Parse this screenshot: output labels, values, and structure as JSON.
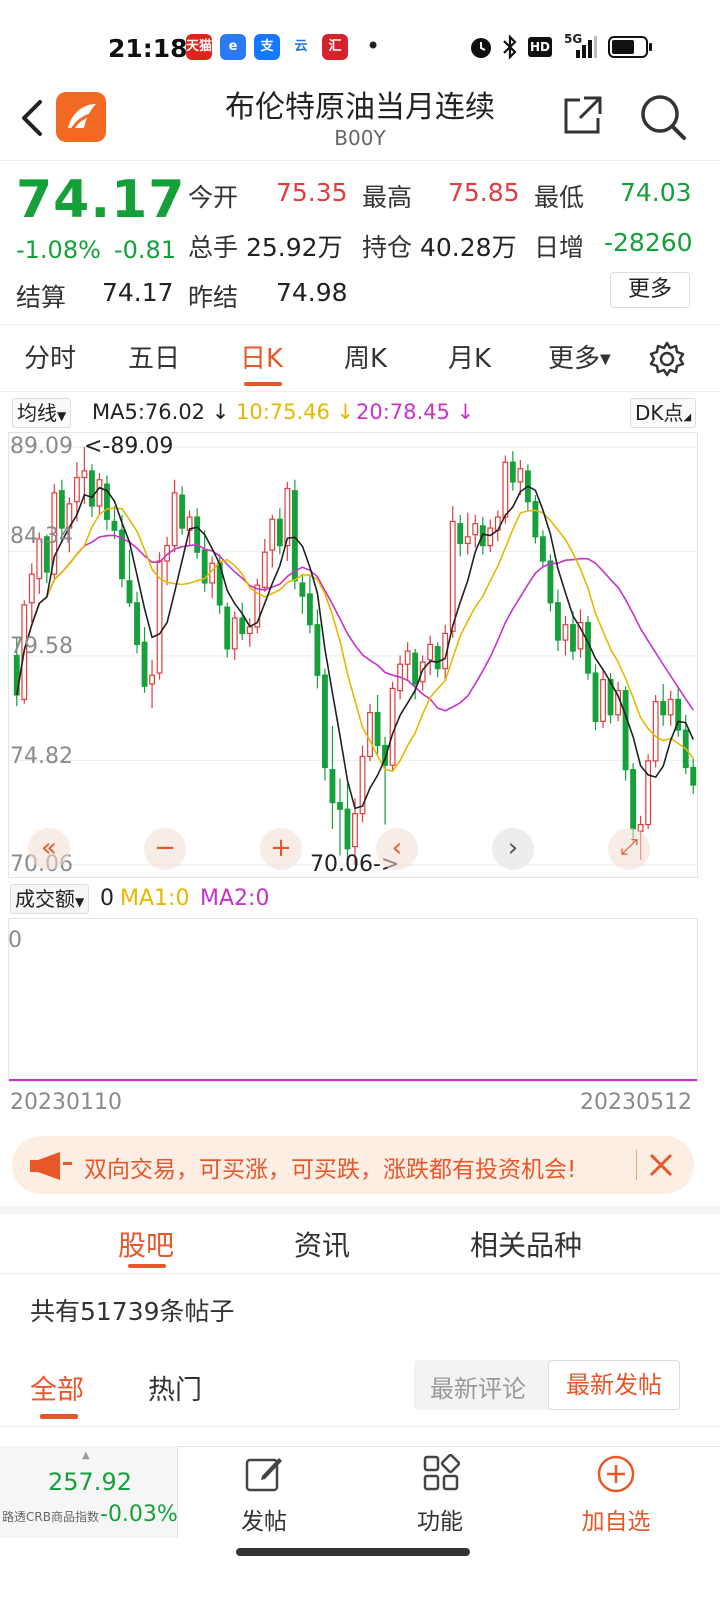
{
  "status_bar": {
    "time": "21:18",
    "apps": [
      "天猫",
      "e",
      "支",
      "云",
      "汇",
      "•"
    ],
    "network": "5G",
    "icons": [
      "alarm-icon",
      "bluetooth-icon",
      "hd-icon",
      "signal-icon",
      "battery-icon"
    ]
  },
  "header": {
    "title": "布伦特原油当月连续",
    "code": "B00Y"
  },
  "quote": {
    "price": "74.17",
    "change_pct": "-1.08%",
    "change_val": "-0.81",
    "open_label": "今开",
    "open": "75.35",
    "high_label": "最高",
    "high": "75.85",
    "low_label": "最低",
    "low": "74.03",
    "volume_label": "总手",
    "volume": "25.92万",
    "oi_label": "持仓",
    "oi": "40.28万",
    "oi_change_label": "日增",
    "oi_change": "-28260",
    "settle_label": "结算",
    "settle": "74.17",
    "prev_settle_label": "昨结",
    "prev_settle": "74.98",
    "more_label": "更多"
  },
  "period_tabs": {
    "items": [
      "分时",
      "五日",
      "日K",
      "周K",
      "月K",
      "更多"
    ],
    "active": "日K"
  },
  "ma_row": {
    "selector": "均线",
    "ma5": "MA5:76.02",
    "ma10": "10:75.46",
    "ma20": "20:78.45",
    "arrow": "↓",
    "dk_label": "DK点"
  },
  "kchart": {
    "y_labels": [
      "89.09",
      "84.34",
      "79.58",
      "74.82",
      "70.06"
    ],
    "max_label": "<-89.09",
    "min_label": "70.06->",
    "colors": {
      "up": "#e23c3c",
      "down": "#15a03a",
      "ma5": "#222222",
      "ma10": "#e6b800",
      "ma20": "#c832c8"
    }
  },
  "chart_data": {
    "type": "candlestick",
    "title": "",
    "ylim": [
      70.06,
      89.09
    ],
    "y_ticks": [
      89.09,
      84.34,
      79.58,
      74.82,
      70.06
    ],
    "x_range": [
      "20230110",
      "20230512"
    ],
    "candles": [
      [
        79.6,
        80.4,
        77.3,
        77.8
      ],
      [
        77.6,
        82.1,
        77.4,
        81.9
      ],
      [
        82.0,
        83.8,
        81.1,
        83.3
      ],
      [
        83.1,
        85.2,
        82.4,
        84.9
      ],
      [
        85.0,
        85.1,
        82.9,
        83.4
      ],
      [
        83.3,
        87.4,
        83.0,
        87.0
      ],
      [
        87.1,
        87.6,
        84.8,
        85.4
      ],
      [
        85.4,
        86.8,
        84.3,
        86.5
      ],
      [
        86.6,
        88.4,
        85.7,
        87.7
      ],
      [
        87.7,
        89.09,
        86.5,
        88.0
      ],
      [
        88.0,
        88.3,
        85.9,
        86.4
      ],
      [
        86.4,
        87.9,
        86.0,
        87.6
      ],
      [
        87.4,
        87.8,
        85.3,
        85.8
      ],
      [
        85.7,
        86.4,
        84.9,
        85.3
      ],
      [
        85.3,
        86.0,
        82.7,
        83.1
      ],
      [
        83.0,
        84.4,
        81.8,
        82.0
      ],
      [
        82.0,
        82.5,
        79.7,
        80.1
      ],
      [
        80.2,
        80.9,
        77.9,
        78.2
      ],
      [
        78.3,
        79.4,
        77.2,
        78.7
      ],
      [
        78.8,
        84.3,
        78.5,
        83.9
      ],
      [
        83.9,
        85.0,
        82.8,
        84.6
      ],
      [
        84.6,
        87.6,
        84.3,
        87.0
      ],
      [
        86.9,
        87.3,
        85.1,
        85.4
      ],
      [
        85.3,
        86.2,
        84.6,
        85.9
      ],
      [
        85.9,
        86.3,
        84.0,
        84.3
      ],
      [
        84.4,
        85.3,
        82.5,
        82.9
      ],
      [
        82.9,
        84.1,
        82.2,
        83.8
      ],
      [
        83.8,
        84.2,
        81.5,
        81.9
      ],
      [
        81.8,
        82.0,
        79.5,
        79.9
      ],
      [
        79.9,
        81.6,
        79.4,
        81.3
      ],
      [
        81.3,
        82.0,
        80.3,
        80.6
      ],
      [
        80.6,
        81.3,
        80.0,
        80.9
      ],
      [
        80.9,
        83.1,
        80.6,
        82.8
      ],
      [
        82.7,
        84.9,
        82.5,
        84.3
      ],
      [
        84.4,
        86.0,
        83.6,
        85.8
      ],
      [
        85.8,
        86.3,
        84.2,
        84.6
      ],
      [
        84.6,
        87.5,
        83.9,
        87.2
      ],
      [
        87.1,
        87.6,
        82.6,
        83.0
      ],
      [
        82.9,
        83.3,
        81.5,
        82.3
      ],
      [
        82.4,
        83.2,
        80.6,
        81.0
      ],
      [
        81.0,
        81.7,
        78.1,
        78.7
      ],
      [
        78.7,
        79.0,
        73.9,
        74.5
      ],
      [
        74.4,
        76.4,
        71.7,
        72.9
      ],
      [
        72.9,
        74.0,
        70.5,
        72.6
      ],
      [
        72.6,
        73.8,
        70.3,
        70.8
      ],
      [
        70.9,
        73.1,
        70.06,
        72.4
      ],
      [
        72.4,
        75.5,
        72.0,
        75.0
      ],
      [
        75.0,
        77.4,
        74.8,
        77.0
      ],
      [
        77.0,
        77.8,
        75.1,
        75.5
      ],
      [
        75.5,
        75.9,
        71.9,
        74.6
      ],
      [
        74.6,
        78.4,
        74.3,
        78.1
      ],
      [
        78.0,
        79.6,
        77.6,
        79.2
      ],
      [
        79.2,
        80.2,
        78.5,
        79.8
      ],
      [
        79.7,
        79.9,
        77.6,
        78.3
      ],
      [
        78.4,
        79.6,
        78.0,
        79.3
      ],
      [
        79.4,
        80.5,
        78.7,
        80.1
      ],
      [
        80.0,
        80.2,
        78.6,
        79.0
      ],
      [
        79.0,
        81.0,
        78.5,
        80.6
      ],
      [
        80.7,
        86.4,
        80.4,
        85.7
      ],
      [
        85.6,
        86.0,
        84.1,
        84.7
      ],
      [
        84.7,
        86.1,
        84.2,
        85.0
      ],
      [
        85.1,
        86.0,
        84.5,
        85.6
      ],
      [
        85.5,
        85.9,
        84.2,
        84.6
      ],
      [
        84.6,
        85.8,
        84.3,
        85.4
      ],
      [
        85.3,
        86.2,
        84.8,
        85.9
      ],
      [
        85.9,
        88.7,
        85.6,
        88.4
      ],
      [
        88.4,
        88.9,
        87.1,
        87.5
      ],
      [
        87.5,
        88.5,
        86.9,
        88.1
      ],
      [
        88.0,
        88.3,
        86.2,
        86.6
      ],
      [
        86.6,
        86.9,
        84.7,
        85.0
      ],
      [
        85.0,
        85.3,
        83.6,
        83.9
      ],
      [
        83.9,
        84.2,
        81.6,
        82.0
      ],
      [
        82.0,
        82.6,
        79.8,
        80.3
      ],
      [
        80.3,
        81.4,
        79.6,
        81.0
      ],
      [
        81.0,
        81.6,
        79.4,
        79.8
      ],
      [
        79.9,
        81.7,
        79.5,
        81.1
      ],
      [
        81.1,
        81.4,
        78.5,
        78.8
      ],
      [
        78.8,
        79.2,
        76.2,
        76.6
      ],
      [
        76.6,
        79.0,
        76.3,
        78.5
      ],
      [
        78.5,
        78.8,
        76.5,
        76.9
      ],
      [
        76.9,
        78.4,
        76.6,
        78.0
      ],
      [
        78.0,
        78.2,
        73.9,
        74.4
      ],
      [
        74.4,
        74.7,
        71.1,
        71.7
      ],
      [
        71.6,
        72.3,
        70.3,
        71.9
      ],
      [
        71.9,
        75.1,
        71.7,
        74.8
      ],
      [
        74.8,
        77.8,
        74.5,
        77.5
      ],
      [
        77.5,
        78.3,
        76.4,
        76.9
      ],
      [
        76.9,
        78.0,
        76.4,
        77.6
      ],
      [
        77.6,
        78.1,
        75.9,
        76.2
      ],
      [
        76.2,
        76.9,
        74.2,
        74.5
      ],
      [
        74.5,
        74.9,
        73.3,
        73.7
      ]
    ],
    "ma_legend": {
      "MA5": 76.02,
      "MA10": 75.46,
      "MA20": 78.45
    }
  },
  "vol": {
    "selector": "成交额",
    "value": "0",
    "ma1": "MA1:0",
    "ma2": "MA2:0",
    "y_label": "0",
    "date_start": "20230110",
    "date_end": "20230512"
  },
  "banner": {
    "text": "双向交易，可买涨，可买跌，涨跌都有投资机会!"
  },
  "lower_tabs": {
    "items": [
      "股吧",
      "资讯",
      "相关品种"
    ],
    "active": "股吧"
  },
  "forum": {
    "post_count": "共有51739条帖子",
    "sub_tabs": [
      "全部",
      "热门"
    ],
    "sort_options": [
      "最新评论",
      "最新发帖"
    ],
    "sort_active": "最新发帖"
  },
  "bottom_bar": {
    "index_value": "257.92",
    "index_name": "路透CRB商品指数",
    "index_change": "-0.03%",
    "post_label": "发帖",
    "func_label": "功能",
    "watch_label": "加自选"
  }
}
